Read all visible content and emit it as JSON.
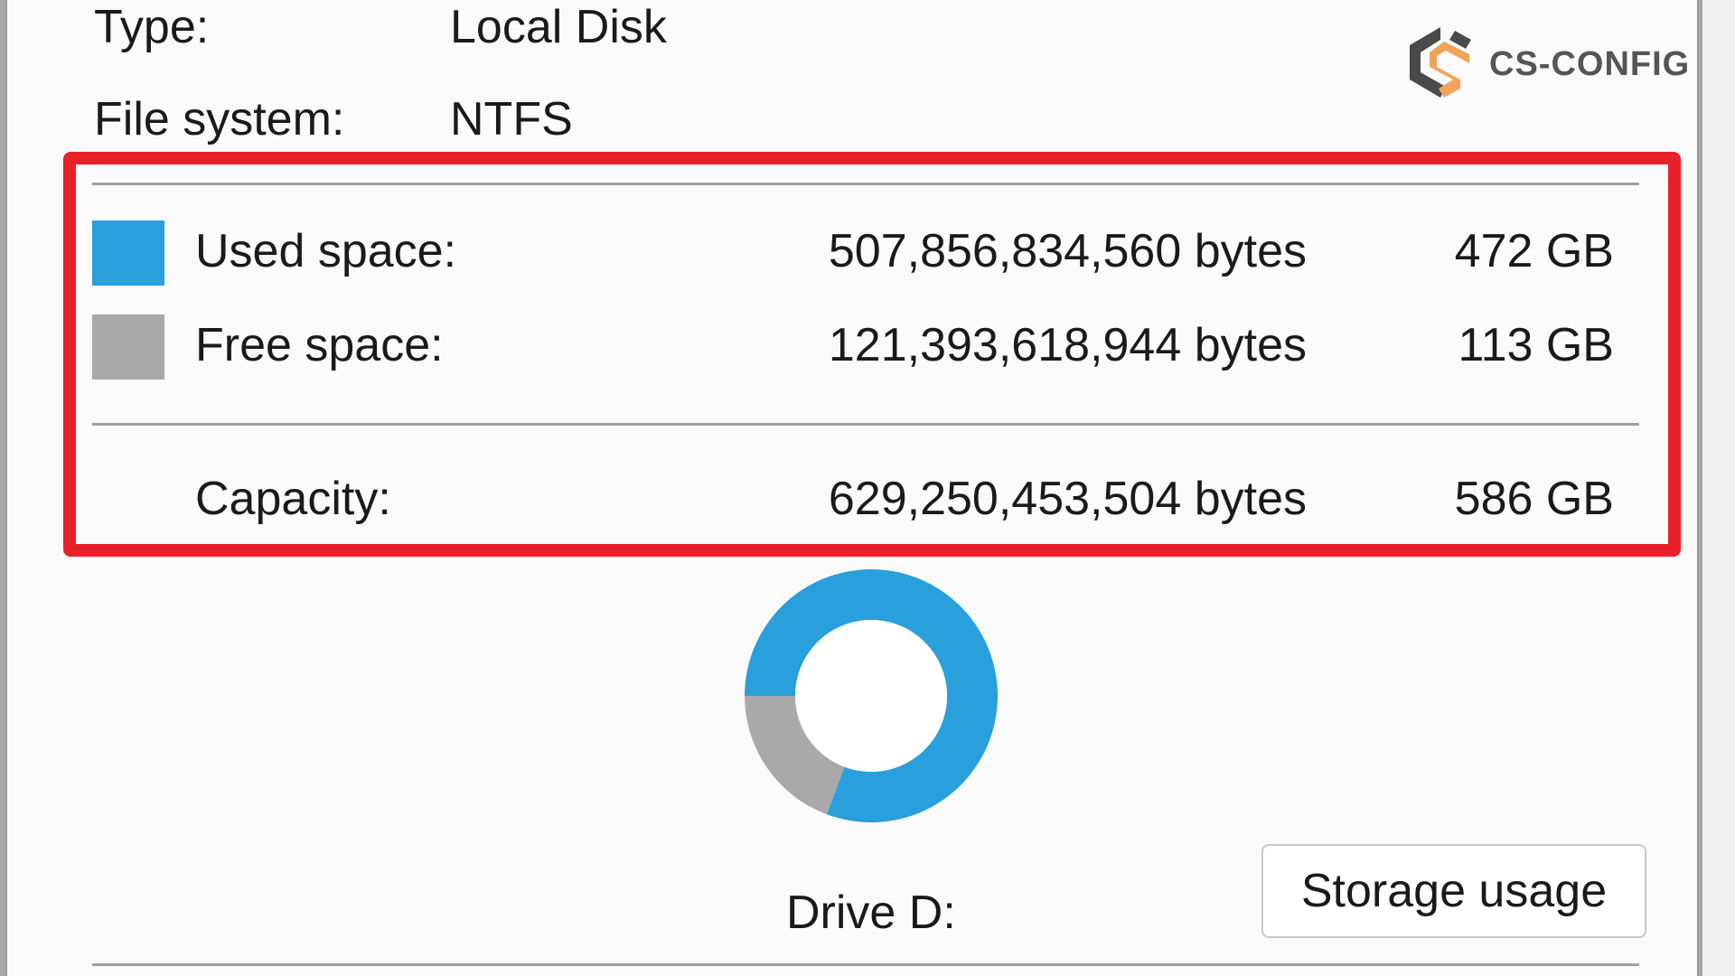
{
  "general": {
    "type_label": "Type:",
    "type_value": "Local Disk",
    "fs_label": "File system:",
    "fs_value": "NTFS"
  },
  "logo": {
    "text": "CS-CONFIG"
  },
  "space": {
    "used": {
      "label": "Used space:",
      "bytes": "507,856,834,560 bytes",
      "size": "472 GB",
      "color": "#29a0dc"
    },
    "free": {
      "label": "Free space:",
      "bytes": "121,393,618,944 bytes",
      "size": "113 GB",
      "color": "#a9a9a9"
    },
    "capacity": {
      "label": "Capacity:",
      "bytes": "629,250,453,504 bytes",
      "size": "586 GB"
    }
  },
  "chart_data": {
    "type": "pie",
    "categories": [
      "Used space",
      "Free space"
    ],
    "values": [
      507856834560,
      121393618944
    ],
    "colors": [
      "#29a0dc",
      "#a9a9a9"
    ]
  },
  "drive": {
    "label": "Drive D:"
  },
  "actions": {
    "storage_usage": "Storage usage"
  }
}
